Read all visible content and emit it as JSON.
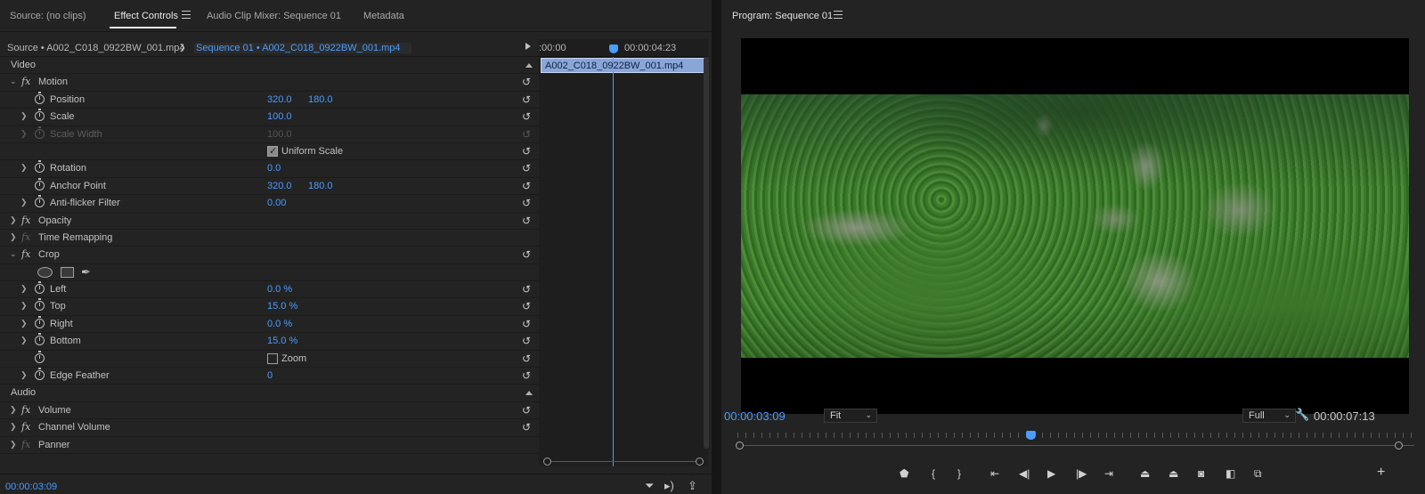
{
  "left_tabs": {
    "source": "Source: (no clips)",
    "effect_controls": "Effect Controls",
    "audio_mixer": "Audio Clip Mixer: Sequence 01",
    "metadata": "Metadata"
  },
  "source_bar": {
    "source_label": "Source • A002_C018_0922BW_001.mp4",
    "sequence_label": "Sequence 01 • A002_C018_0922BW_001.mp4"
  },
  "mini_timeline": {
    "start_time": ":00:00",
    "end_time": "00:00:04:23",
    "clip_name": "A002_C018_0922BW_001.mp4"
  },
  "effects": {
    "video_header": "Video",
    "motion": "Motion",
    "position_label": "Position",
    "position_x": "320.0",
    "position_y": "180.0",
    "scale_label": "Scale",
    "scale_value": "100.0",
    "scale_width_label": "Scale Width",
    "scale_width_value": "100.0",
    "uniform_scale_label": "Uniform Scale",
    "rotation_label": "Rotation",
    "rotation_value": "0.0",
    "anchor_label": "Anchor Point",
    "anchor_x": "320.0",
    "anchor_y": "180.0",
    "antiflicker_label": "Anti-flicker Filter",
    "antiflicker_value": "0.00",
    "opacity": "Opacity",
    "time_remap": "Time Remapping",
    "crop": "Crop",
    "left_label": "Left",
    "left_value": "0.0 %",
    "top_label": "Top",
    "top_value": "15.0 %",
    "right_label": "Right",
    "right_value": "0.0 %",
    "bottom_label": "Bottom",
    "bottom_value": "15.0 %",
    "zoom_label": "Zoom",
    "edge_feather_label": "Edge Feather",
    "edge_feather_value": "0",
    "audio_header": "Audio",
    "volume": "Volume",
    "channel_volume": "Channel Volume",
    "panner": "Panner"
  },
  "left_bottom": {
    "timecode": "00:00:03:09"
  },
  "program": {
    "title": "Program: Sequence 01",
    "current_tc": "00:00:03:09",
    "fit_value": "Fit",
    "quality_value": "Full",
    "duration_tc": "00:00:07:13",
    "playhead_fraction": 0.435
  },
  "icons": {
    "reset": "reset-icon",
    "stopwatch": "stopwatch-icon",
    "wrench": "wrench-icon"
  },
  "colors": {
    "accent": "#4a9cff",
    "panel": "#232323"
  }
}
